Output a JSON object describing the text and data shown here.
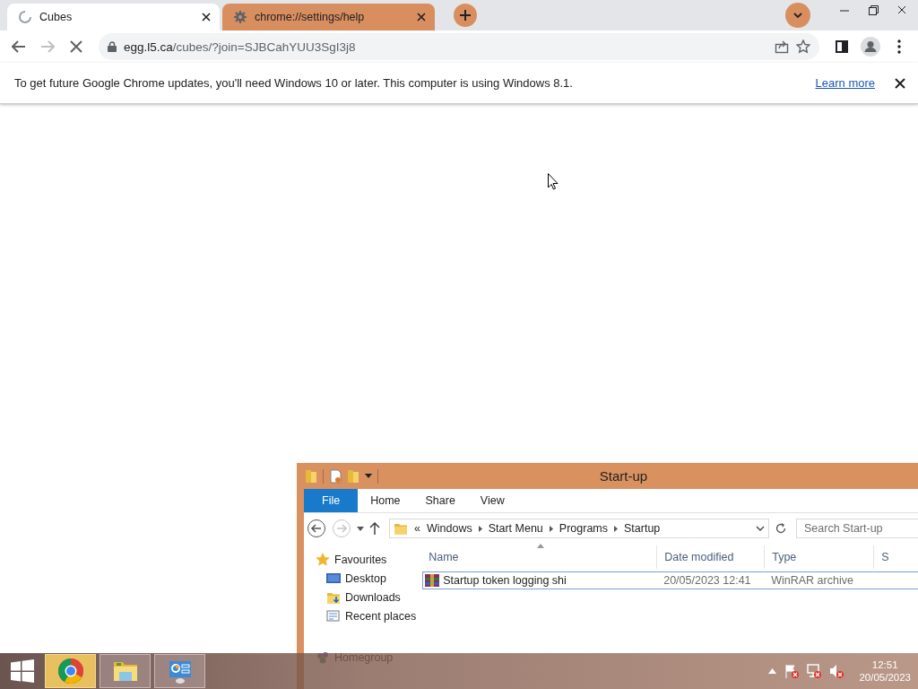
{
  "browser": {
    "tabs": [
      {
        "title": "Cubes",
        "selected": true,
        "loading": true
      },
      {
        "title": "chrome://settings/help",
        "selected": false,
        "loading": false
      }
    ],
    "address": {
      "host": "egg.l5.ca",
      "path": "/cubes/?join=SJBCahYUU3SgI3j8"
    },
    "infobar": {
      "message": "To get future Google Chrome updates, you'll need Windows 10 or later. This computer is using Windows 8.1.",
      "link": "Learn more"
    }
  },
  "explorer": {
    "title": "Start-up",
    "ribbon_tabs": [
      {
        "label": "File",
        "selected": true
      },
      {
        "label": "Home",
        "selected": false
      },
      {
        "label": "Share",
        "selected": false
      },
      {
        "label": "View",
        "selected": false
      }
    ],
    "breadcrumb_overflow": "«",
    "breadcrumb": [
      "Windows",
      "Start Menu",
      "Programs",
      "Startup"
    ],
    "search": {
      "placeholder": "Search Start-up"
    },
    "nav": [
      {
        "label": "Favourites",
        "kind": "favourites",
        "children": [
          {
            "label": "Desktop",
            "kind": "desktop"
          },
          {
            "label": "Downloads",
            "kind": "downloads"
          },
          {
            "label": "Recent places",
            "kind": "recent"
          }
        ]
      },
      {
        "label": "Homegroup",
        "kind": "homegroup"
      }
    ],
    "columns": [
      "Name",
      "Date modified",
      "Type",
      "S"
    ],
    "rows": [
      {
        "name": "Startup token logging shi",
        "date": "20/05/2023 12:41",
        "type": "WinRAR archive",
        "selected": true
      }
    ]
  },
  "taskbar": {
    "apps": [
      {
        "kind": "chrome",
        "selected": true
      },
      {
        "kind": "explorer",
        "selected": false
      },
      {
        "kind": "control-panel",
        "selected": false
      }
    ],
    "clock": {
      "time": "12:51",
      "date": "20/05/2023"
    }
  }
}
